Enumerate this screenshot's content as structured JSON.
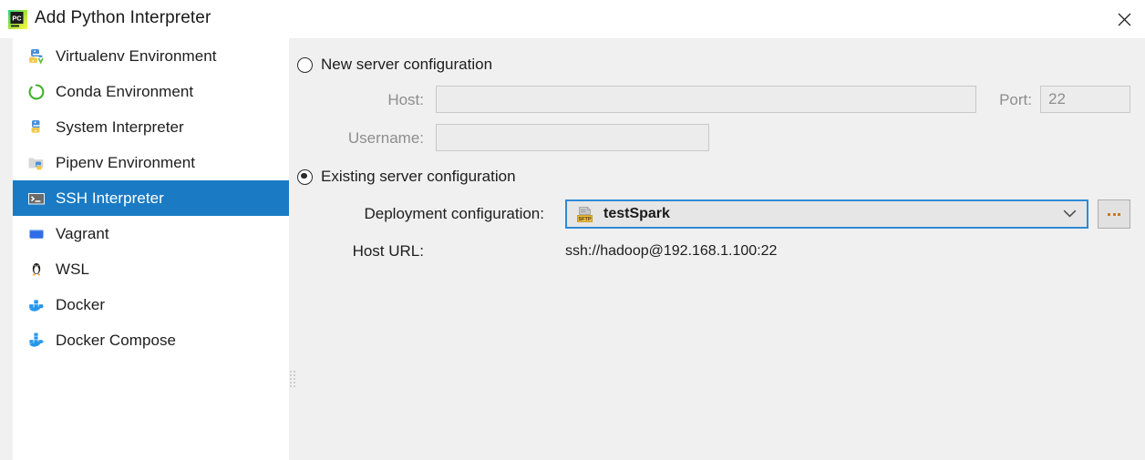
{
  "window": {
    "title": "Add Python Interpreter",
    "app_icon": "pycharm-icon",
    "close_icon": "close-icon"
  },
  "sidebar": {
    "items": [
      {
        "label": "Virtualenv Environment",
        "icon": "virtualenv-icon",
        "selected": false
      },
      {
        "label": "Conda Environment",
        "icon": "conda-icon",
        "selected": false
      },
      {
        "label": "System Interpreter",
        "icon": "python-icon",
        "selected": false
      },
      {
        "label": "Pipenv Environment",
        "icon": "pipenv-icon",
        "selected": false
      },
      {
        "label": "SSH Interpreter",
        "icon": "terminal-icon",
        "selected": true
      },
      {
        "label": "Vagrant",
        "icon": "vagrant-icon",
        "selected": false
      },
      {
        "label": "WSL",
        "icon": "linux-penguin-icon",
        "selected": false
      },
      {
        "label": "Docker",
        "icon": "docker-icon",
        "selected": false
      },
      {
        "label": "Docker Compose",
        "icon": "docker-compose-icon",
        "selected": false
      }
    ]
  },
  "main": {
    "new_server": {
      "radio_label": "New server configuration",
      "selected": false,
      "host_label": "Host:",
      "host_value": "",
      "port_label": "Port:",
      "port_value": "22",
      "username_label": "Username:",
      "username_value": ""
    },
    "existing_server": {
      "radio_label": "Existing server configuration",
      "selected": true,
      "deployment_label": "Deployment configuration:",
      "deployment_value": "testSpark",
      "deployment_icon": "sftp-icon",
      "browse_label": "...",
      "host_url_label": "Host URL:",
      "host_url_value": "ssh://hadoop@192.168.1.100:22"
    }
  },
  "colors": {
    "selection_blue": "#1a7bc4",
    "focus_blue": "#2f8ad6",
    "background": "#f0f0f0",
    "panel_white": "#ffffff",
    "disabled_text": "#8d8d8d"
  }
}
